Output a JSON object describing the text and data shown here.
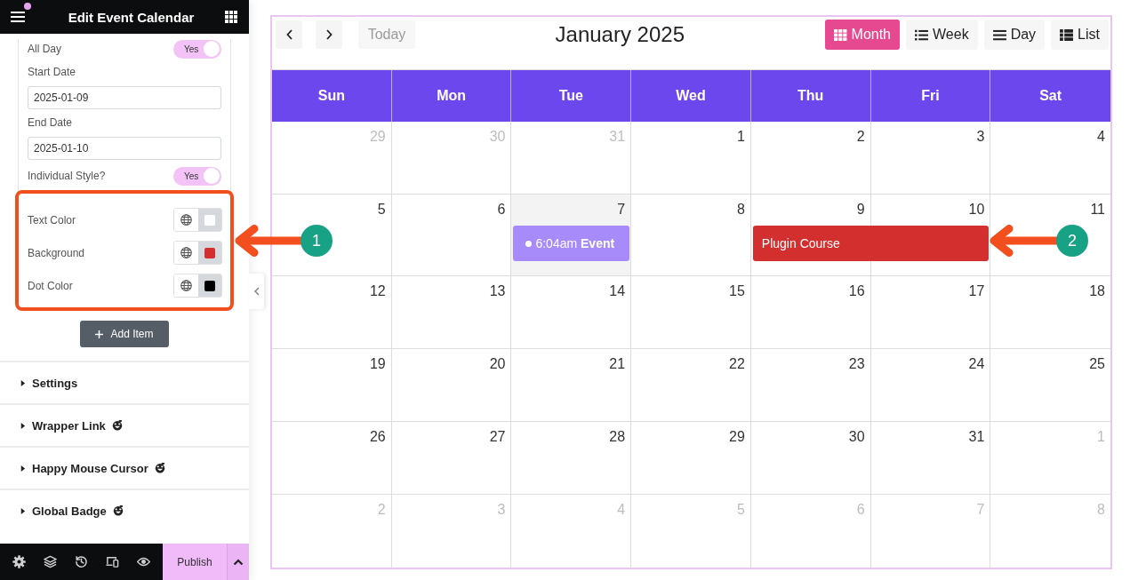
{
  "editor": {
    "title": "Edit Event Calendar",
    "notification": true
  },
  "fields": [
    {
      "kind": "toggle",
      "label": "All Day",
      "value": "Yes",
      "on": true
    },
    {
      "kind": "date",
      "label": "Start Date",
      "value": "2025-01-09"
    },
    {
      "kind": "date",
      "label": "End Date",
      "value": "2025-01-10"
    },
    {
      "kind": "toggle",
      "label": "Individual Style?",
      "value": "Yes",
      "on": true
    }
  ],
  "style_group": {
    "highlighted": true,
    "items": [
      {
        "label": "Text Color",
        "color": "#ffffff"
      },
      {
        "label": "Background",
        "color": "#d32f2f"
      },
      {
        "label": "Dot Color",
        "color": "#000000"
      }
    ]
  },
  "add_item_button": "Add Item",
  "sections": [
    {
      "label": "Settings",
      "expanded": false,
      "addon_icon": false
    },
    {
      "label": "Wrapper Link",
      "expanded": false,
      "addon_icon": true
    },
    {
      "label": "Happy Mouse Cursor",
      "expanded": false,
      "addon_icon": true
    },
    {
      "label": "Global Badge",
      "expanded": false,
      "addon_icon": true
    }
  ],
  "bottom_bar": {
    "publish_button": "Publish"
  },
  "calendar": {
    "today_button": {
      "label": "Today",
      "disabled": true
    },
    "title": "January 2025",
    "views": [
      {
        "label": "Month",
        "selected": true
      },
      {
        "label": "Week",
        "selected": false
      },
      {
        "label": "Day",
        "selected": false
      },
      {
        "label": "List",
        "selected": false
      }
    ],
    "weekdays": [
      "Sun",
      "Mon",
      "Tue",
      "Wed",
      "Thu",
      "Fri",
      "Sat"
    ],
    "weeks": [
      {
        "days": [
          {
            "day": "29",
            "other_month": true,
            "today": false
          },
          {
            "day": "30",
            "other_month": true,
            "today": false
          },
          {
            "day": "31",
            "other_month": true,
            "today": false
          },
          {
            "day": "1",
            "other_month": false,
            "today": false
          },
          {
            "day": "2",
            "other_month": false,
            "today": false
          },
          {
            "day": "3",
            "other_month": false,
            "today": false
          },
          {
            "day": "4",
            "other_month": false,
            "today": false
          }
        ]
      },
      {
        "days": [
          {
            "day": "5",
            "other_month": false,
            "today": false
          },
          {
            "day": "6",
            "other_month": false,
            "today": false
          },
          {
            "day": "7",
            "other_month": false,
            "today": true,
            "events": [
              {
                "kind": "timed",
                "time": "6:04am",
                "title": "Event",
                "color": "#a78bfa",
                "continues_next_day": false
              }
            ]
          },
          {
            "day": "8",
            "other_month": false,
            "today": false
          },
          {
            "day": "9",
            "other_month": false,
            "today": false,
            "events": [
              {
                "kind": "block",
                "title": "Plugin Course",
                "color": "#d32f2f",
                "continues_next_day": true
              }
            ]
          },
          {
            "day": "10",
            "other_month": false,
            "today": false
          },
          {
            "day": "11",
            "other_month": false,
            "today": false
          }
        ]
      },
      {
        "days": [
          {
            "day": "12",
            "other_month": false,
            "today": false
          },
          {
            "day": "13",
            "other_month": false,
            "today": false
          },
          {
            "day": "14",
            "other_month": false,
            "today": false
          },
          {
            "day": "15",
            "other_month": false,
            "today": false
          },
          {
            "day": "16",
            "other_month": false,
            "today": false
          },
          {
            "day": "17",
            "other_month": false,
            "today": false
          },
          {
            "day": "18",
            "other_month": false,
            "today": false
          }
        ]
      },
      {
        "days": [
          {
            "day": "19",
            "other_month": false,
            "today": false
          },
          {
            "day": "20",
            "other_month": false,
            "today": false
          },
          {
            "day": "21",
            "other_month": false,
            "today": false
          },
          {
            "day": "22",
            "other_month": false,
            "today": false
          },
          {
            "day": "23",
            "other_month": false,
            "today": false
          },
          {
            "day": "24",
            "other_month": false,
            "today": false
          },
          {
            "day": "25",
            "other_month": false,
            "today": false
          }
        ]
      },
      {
        "days": [
          {
            "day": "26",
            "other_month": false,
            "today": false
          },
          {
            "day": "27",
            "other_month": false,
            "today": false
          },
          {
            "day": "28",
            "other_month": false,
            "today": false
          },
          {
            "day": "29",
            "other_month": false,
            "today": false
          },
          {
            "day": "30",
            "other_month": false,
            "today": false
          },
          {
            "day": "31",
            "other_month": false,
            "today": false
          },
          {
            "day": "1",
            "other_month": true,
            "today": false
          }
        ]
      },
      {
        "days": [
          {
            "day": "2",
            "other_month": true,
            "today": false
          },
          {
            "day": "3",
            "other_month": true,
            "today": false
          },
          {
            "day": "4",
            "other_month": true,
            "today": false
          },
          {
            "day": "5",
            "other_month": true,
            "today": false
          },
          {
            "day": "6",
            "other_month": true,
            "today": false
          },
          {
            "day": "7",
            "other_month": true,
            "today": false
          },
          {
            "day": "8",
            "other_month": true,
            "today": false
          }
        ]
      }
    ]
  },
  "annotations": [
    {
      "number": "1"
    },
    {
      "number": "2"
    }
  ]
}
